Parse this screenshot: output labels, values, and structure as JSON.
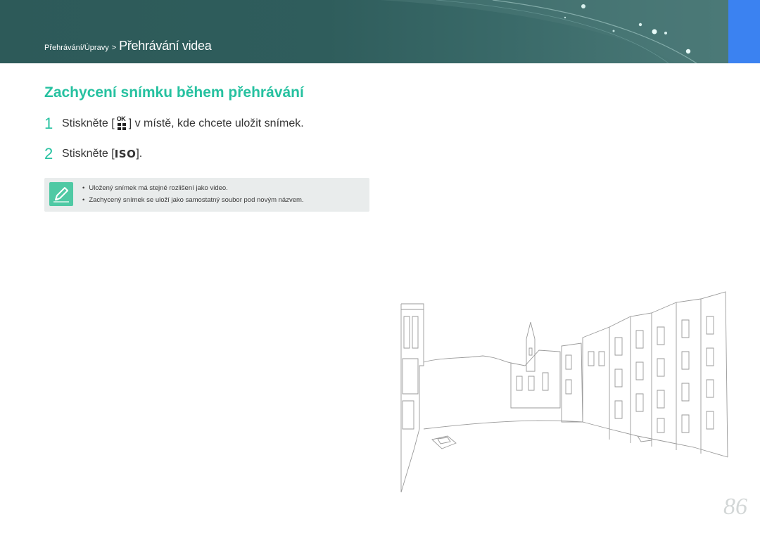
{
  "header": {
    "breadcrumb_parent": "Přehrávání/Úpravy",
    "breadcrumb_separator": ">",
    "breadcrumb_current": "Přehrávání videa"
  },
  "section": {
    "title": "Zachycení snímku během přehrávání"
  },
  "steps": [
    {
      "number": "1",
      "text_before": "Stiskněte [",
      "icon": "ok-grid-icon",
      "icon_label": "OK",
      "text_after": "] v místě, kde chcete uložit snímek."
    },
    {
      "number": "2",
      "text_before": "Stiskněte [",
      "key": "ISO",
      "text_after": "]."
    }
  ],
  "note": {
    "icon": "pencil-note-icon",
    "items": [
      "Uložený snímek má stejné rozlišení jako video.",
      "Zachycený snímek se uloží jako samostatný soubor pod novým názvem."
    ]
  },
  "page_number": "86",
  "colors": {
    "accent": "#26c1a0",
    "header_bg": "#2d5a59",
    "tab_blue": "#3b82f1",
    "note_bg": "#e9ecec",
    "note_icon_bg": "#4fc9a4"
  }
}
